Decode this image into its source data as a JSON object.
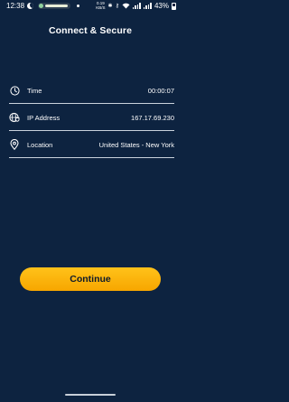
{
  "status_bar": {
    "time": "12:38",
    "speed_value": "0.19",
    "speed_unit": "KB/S",
    "battery_percent": "43%"
  },
  "header": {
    "title": "Connect & Secure"
  },
  "info": {
    "time": {
      "icon": "clock-icon",
      "label": "Time",
      "value": "00:00:07"
    },
    "ip": {
      "icon": "globe-shield-icon",
      "label": "IP Address",
      "value": "167.17.69.230"
    },
    "location": {
      "icon": "location-pin-icon",
      "label": "Location",
      "value": "United States - New York"
    }
  },
  "actions": {
    "continue_label": "Continue"
  },
  "colors": {
    "background": "#0d2340",
    "accent": "#ffb80d",
    "text": "#ffffff"
  }
}
